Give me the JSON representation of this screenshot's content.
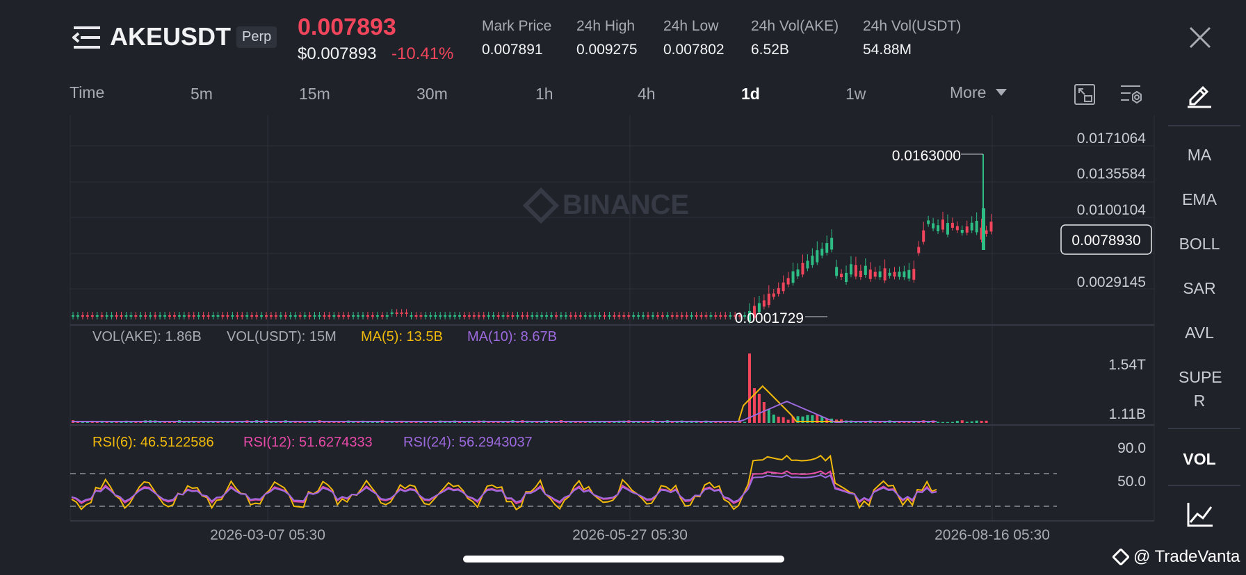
{
  "header": {
    "symbol": "AKEUSDT",
    "contract": "Perp",
    "last_price": "0.007893",
    "usd_price": "$0.007893",
    "change_pct": "-10.41%",
    "stats": [
      {
        "label": "Mark Price",
        "value": "0.007891"
      },
      {
        "label": "24h High",
        "value": "0.009275"
      },
      {
        "label": "24h Low",
        "value": "0.007802"
      },
      {
        "label": "24h Vol(AKE)",
        "value": "6.52B"
      },
      {
        "label": "24h Vol(USDT)",
        "value": "54.88M"
      }
    ]
  },
  "timeframes": [
    "Time",
    "5m",
    "15m",
    "30m",
    "1h",
    "4h",
    "1d",
    "1w",
    "More"
  ],
  "active_timeframe": "1d",
  "indicators": [
    "MA",
    "EMA",
    "BOLL",
    "SAR",
    "AVL",
    "SUPE R"
  ],
  "sub_indicator": "VOL",
  "watermark": "BINANCE",
  "footer_brand": "@ TradeVanta",
  "colors": {
    "up": "#2ebd85",
    "down": "#f0455b",
    "ma5": "#f0b90b",
    "ma10": "#9c6ade",
    "rsi12": "#e84aa8",
    "bg": "#1f2229"
  },
  "chart_data": [
    {
      "type": "candlestick",
      "price_axis_labels": [
        "0.0171064",
        "0.0135584",
        "0.0100104",
        "0.0029145"
      ],
      "current_price_tag": "0.0078930",
      "annotations": {
        "high": "0.0163000",
        "low": "0.0001729"
      },
      "x_tick_labels": [
        "2026-03-07 05:30",
        "2026-05-27 05:30",
        "2026-08-16 05:30"
      ],
      "grid": true
    },
    {
      "type": "bar",
      "legend": {
        "vol_base": "VOL(AKE): 1.86B",
        "vol_quote": "VOL(USDT): 15M",
        "ma5": "MA(5): 13.5B",
        "ma10": "MA(10): 8.67B"
      },
      "axis_labels": [
        "1.54T",
        "1.11B"
      ]
    },
    {
      "type": "line",
      "legend": {
        "rsi6": "RSI(6): 46.5122586",
        "rsi12": "RSI(12): 51.6274333",
        "rsi24": "RSI(24): 56.2943037"
      },
      "axis_labels": [
        "90.0",
        "50.0"
      ],
      "levels": [
        70,
        30
      ]
    }
  ]
}
